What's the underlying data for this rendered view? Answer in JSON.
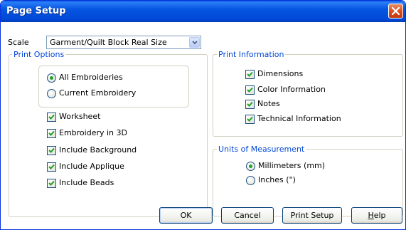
{
  "window": {
    "title": "Page Setup"
  },
  "scale": {
    "label": "Scale",
    "value": "Garment/Quilt Block Real Size"
  },
  "print_options": {
    "legend": "Print Options",
    "radios": [
      {
        "label": "All Embroideries",
        "selected": true
      },
      {
        "label": "Current Embroidery",
        "selected": false
      }
    ],
    "checkboxes": [
      {
        "label": "Worksheet",
        "checked": true
      },
      {
        "label": "Embroidery in 3D",
        "checked": true
      },
      {
        "label": "Include Background",
        "checked": true
      },
      {
        "label": "Include Applique",
        "checked": true
      },
      {
        "label": "Include Beads",
        "checked": true
      }
    ]
  },
  "print_information": {
    "legend": "Print Information",
    "checkboxes": [
      {
        "label": "Dimensions",
        "checked": true
      },
      {
        "label": "Color Information",
        "checked": true
      },
      {
        "label": "Notes",
        "checked": true
      },
      {
        "label": "Technical Information",
        "checked": true
      }
    ]
  },
  "units": {
    "legend": "Units of Measurement",
    "radios": [
      {
        "label": "Millimeters (mm)",
        "selected": true
      },
      {
        "label": "Inches (\")",
        "selected": false
      }
    ]
  },
  "buttons": {
    "ok": "OK",
    "cancel": "Cancel",
    "print_setup": "Print Setup",
    "help_first": "H",
    "help_rest": "elp"
  }
}
